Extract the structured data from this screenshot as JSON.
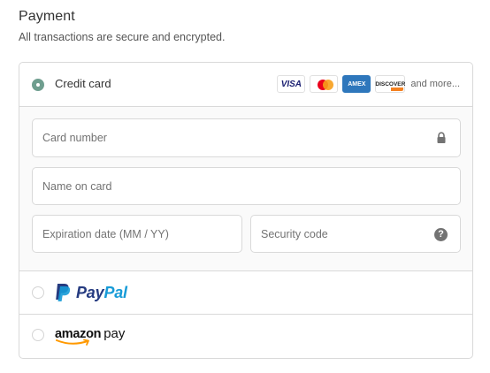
{
  "section": {
    "title": "Payment",
    "subtitle": "All transactions are secure and encrypted."
  },
  "payment_methods": {
    "credit_card": {
      "label": "Credit card",
      "selected": true,
      "card_brands": [
        "VISA",
        "Mastercard",
        "AMEX",
        "DISCOVER"
      ],
      "visa_text": "VISA",
      "amex_text": "AMEX",
      "discover_text": "DISCOVER",
      "more_text": "and more..."
    },
    "paypal": {
      "selected": false,
      "logo_part1": "Pay",
      "logo_part2": "Pal"
    },
    "amazon_pay": {
      "selected": false,
      "logo_word": "amazon",
      "logo_pay": "pay"
    }
  },
  "card_form": {
    "card_number": {
      "placeholder": "Card number",
      "value": ""
    },
    "name_on_card": {
      "placeholder": "Name on card",
      "value": ""
    },
    "expiration": {
      "placeholder": "Expiration date (MM / YY)",
      "value": ""
    },
    "security_code": {
      "placeholder": "Security code",
      "value": ""
    },
    "help_glyph": "?"
  },
  "colors": {
    "accent": "#6f9e8f",
    "border": "#d9d9d9",
    "paypal_dark": "#253b80",
    "paypal_light": "#179bd7",
    "amazon_orange": "#ff9900"
  },
  "icons": [
    "lock-icon",
    "help-icon",
    "visa-icon",
    "mastercard-icon",
    "amex-icon",
    "discover-icon",
    "paypal-icon",
    "amazon-pay-icon"
  ]
}
